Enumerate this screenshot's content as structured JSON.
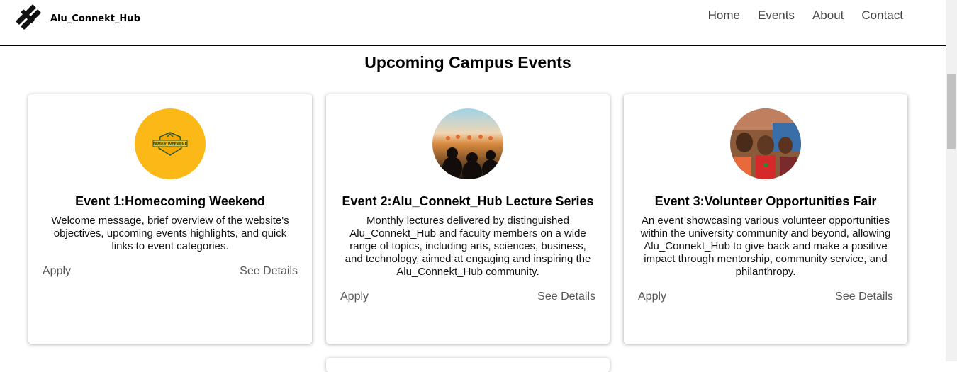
{
  "header": {
    "brand": "Alu_Connekt_Hub",
    "nav": [
      "Home",
      "Events",
      "About",
      "Contact"
    ]
  },
  "page_title": "Upcoming Campus Events",
  "events": [
    {
      "title": "Event 1:Homecoming Weekend",
      "description": "Welcome message, brief overview of the website's objectives, upcoming events highlights, and quick links to event categories.",
      "apply_label": "Apply",
      "details_label": "See Details",
      "badge_text": "FAMILY WEEKEND"
    },
    {
      "title": "Event 2:Alu_Connekt_Hub Lecture Series",
      "description": "Monthly lectures delivered by distinguished Alu_Connekt_Hub and faculty members on a wide range of topics, including arts, sciences, business, and technology, aimed at engaging and inspiring the Alu_Connekt_Hub community.",
      "apply_label": "Apply",
      "details_label": "See Details"
    },
    {
      "title": "Event 3:Volunteer Opportunities Fair",
      "description": "An event showcasing various volunteer opportunities within the university community and beyond, allowing Alu_Connekt_Hub to give back and make a positive impact through mentorship, community service, and philanthropy.",
      "apply_label": "Apply",
      "details_label": "See Details"
    }
  ],
  "icons": {
    "logo": "logo-icon"
  }
}
